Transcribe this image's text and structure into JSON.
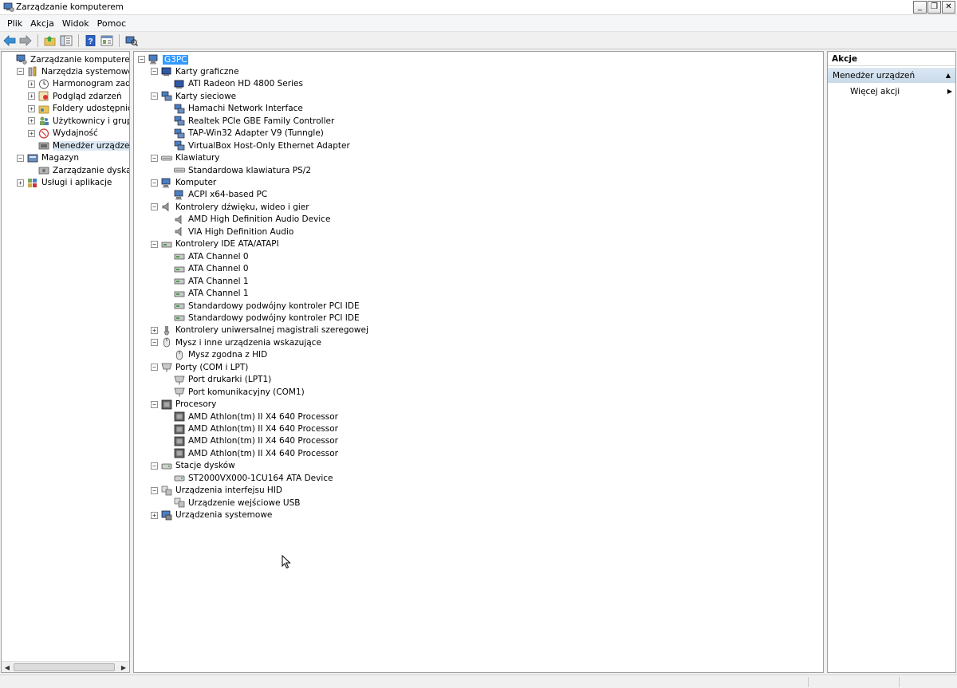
{
  "window": {
    "title": "Zarządzanie komputerem",
    "buttons": {
      "minimize": "_",
      "restore": "❐",
      "close": "✕"
    }
  },
  "menu": [
    "Plik",
    "Akcja",
    "Widok",
    "Pomoc"
  ],
  "toolbar": [
    "back-icon",
    "forward-icon",
    "up-folder-icon",
    "show-hide-tree-icon",
    "help-icon",
    "properties-icon",
    "scan-hardware-icon"
  ],
  "nav_tree": [
    {
      "label": "Zarządzanie komputerem (loka",
      "level": 0,
      "expander": "",
      "icon": "computer-management-icon"
    },
    {
      "label": "Narzędzia systemowe",
      "level": 1,
      "expander": "−",
      "icon": "tools-icon"
    },
    {
      "label": "Harmonogram zadań",
      "level": 2,
      "expander": "+",
      "icon": "clock-icon"
    },
    {
      "label": "Podgląd zdarzeń",
      "level": 2,
      "expander": "+",
      "icon": "event-viewer-icon"
    },
    {
      "label": "Foldery udostępnione",
      "level": 2,
      "expander": "+",
      "icon": "shared-folder-icon"
    },
    {
      "label": "Użytkownicy i grupy lok",
      "level": 2,
      "expander": "+",
      "icon": "users-icon"
    },
    {
      "label": "Wydajność",
      "level": 2,
      "expander": "+",
      "icon": "performance-icon"
    },
    {
      "label": "Menedżer urządzeń",
      "level": 2,
      "expander": "",
      "icon": "device-manager-icon",
      "selected": true
    },
    {
      "label": "Magazyn",
      "level": 1,
      "expander": "−",
      "icon": "storage-icon"
    },
    {
      "label": "Zarządzanie dyskami",
      "level": 2,
      "expander": "",
      "icon": "disk-management-icon"
    },
    {
      "label": "Usługi i aplikacje",
      "level": 1,
      "expander": "+",
      "icon": "services-icon"
    }
  ],
  "device_tree": [
    {
      "label": "G3PC",
      "level": 0,
      "expander": "−",
      "icon": "computer-icon",
      "root": true
    },
    {
      "label": "Karty graficzne",
      "level": 1,
      "expander": "−",
      "icon": "display-adapter-icon"
    },
    {
      "label": "ATI Radeon HD 4800 Series",
      "level": 2,
      "expander": "",
      "icon": "display-adapter-icon"
    },
    {
      "label": "Karty sieciowe",
      "level": 1,
      "expander": "−",
      "icon": "network-adapter-icon"
    },
    {
      "label": "Hamachi Network Interface",
      "level": 2,
      "expander": "",
      "icon": "network-adapter-icon"
    },
    {
      "label": "Realtek PCIe GBE Family Controller",
      "level": 2,
      "expander": "",
      "icon": "network-adapter-icon"
    },
    {
      "label": "TAP-Win32 Adapter V9 (Tunngle)",
      "level": 2,
      "expander": "",
      "icon": "network-adapter-icon"
    },
    {
      "label": "VirtualBox Host-Only Ethernet Adapter",
      "level": 2,
      "expander": "",
      "icon": "network-adapter-icon"
    },
    {
      "label": "Klawiatury",
      "level": 1,
      "expander": "−",
      "icon": "keyboard-icon"
    },
    {
      "label": "Standardowa klawiatura PS/2",
      "level": 2,
      "expander": "",
      "icon": "keyboard-icon"
    },
    {
      "label": "Komputer",
      "level": 1,
      "expander": "−",
      "icon": "computer-icon"
    },
    {
      "label": "ACPI x64-based PC",
      "level": 2,
      "expander": "",
      "icon": "computer-icon"
    },
    {
      "label": "Kontrolery dźwięku, wideo i gier",
      "level": 1,
      "expander": "−",
      "icon": "speaker-icon"
    },
    {
      "label": "AMD High Definition Audio Device",
      "level": 2,
      "expander": "",
      "icon": "speaker-icon"
    },
    {
      "label": "VIA High Definition Audio",
      "level": 2,
      "expander": "",
      "icon": "speaker-icon"
    },
    {
      "label": "Kontrolery IDE ATA/ATAPI",
      "level": 1,
      "expander": "−",
      "icon": "ide-controller-icon"
    },
    {
      "label": "ATA Channel 0",
      "level": 2,
      "expander": "",
      "icon": "ide-controller-icon"
    },
    {
      "label": "ATA Channel 0",
      "level": 2,
      "expander": "",
      "icon": "ide-controller-icon"
    },
    {
      "label": "ATA Channel 1",
      "level": 2,
      "expander": "",
      "icon": "ide-controller-icon"
    },
    {
      "label": "ATA Channel 1",
      "level": 2,
      "expander": "",
      "icon": "ide-controller-icon"
    },
    {
      "label": "Standardowy podwójny kontroler PCI IDE",
      "level": 2,
      "expander": "",
      "icon": "ide-controller-icon"
    },
    {
      "label": "Standardowy podwójny kontroler PCI IDE",
      "level": 2,
      "expander": "",
      "icon": "ide-controller-icon"
    },
    {
      "label": "Kontrolery uniwersalnej magistrali szeregowej",
      "level": 1,
      "expander": "+",
      "icon": "usb-icon"
    },
    {
      "label": "Mysz i inne urządzenia wskazujące",
      "level": 1,
      "expander": "−",
      "icon": "mouse-icon"
    },
    {
      "label": "Mysz zgodna z HID",
      "level": 2,
      "expander": "",
      "icon": "mouse-icon"
    },
    {
      "label": "Porty (COM i LPT)",
      "level": 1,
      "expander": "−",
      "icon": "port-icon"
    },
    {
      "label": "Port drukarki (LPT1)",
      "level": 2,
      "expander": "",
      "icon": "port-icon"
    },
    {
      "label": "Port komunikacyjny (COM1)",
      "level": 2,
      "expander": "",
      "icon": "port-icon"
    },
    {
      "label": "Procesory",
      "level": 1,
      "expander": "−",
      "icon": "processor-icon"
    },
    {
      "label": "AMD Athlon(tm) II X4 640 Processor",
      "level": 2,
      "expander": "",
      "icon": "processor-icon"
    },
    {
      "label": "AMD Athlon(tm) II X4 640 Processor",
      "level": 2,
      "expander": "",
      "icon": "processor-icon"
    },
    {
      "label": "AMD Athlon(tm) II X4 640 Processor",
      "level": 2,
      "expander": "",
      "icon": "processor-icon"
    },
    {
      "label": "AMD Athlon(tm) II X4 640 Processor",
      "level": 2,
      "expander": "",
      "icon": "processor-icon"
    },
    {
      "label": "Stacje dysków",
      "level": 1,
      "expander": "−",
      "icon": "disk-drive-icon"
    },
    {
      "label": "ST2000VX000-1CU164 ATA Device",
      "level": 2,
      "expander": "",
      "icon": "disk-drive-icon"
    },
    {
      "label": "Urządzenia interfejsu HID",
      "level": 1,
      "expander": "−",
      "icon": "hid-icon"
    },
    {
      "label": "Urządzenie wejściowe USB",
      "level": 2,
      "expander": "",
      "icon": "hid-icon"
    },
    {
      "label": "Urządzenia systemowe",
      "level": 1,
      "expander": "+",
      "icon": "system-device-icon"
    }
  ],
  "actions": {
    "header": "Akcje",
    "section": "Menedżer urządzeń",
    "more": "Więcej akcji"
  },
  "colors": {
    "selection": "#3399ff",
    "nav_selection": "#dde9f5",
    "actions_section": "#c9daea"
  }
}
